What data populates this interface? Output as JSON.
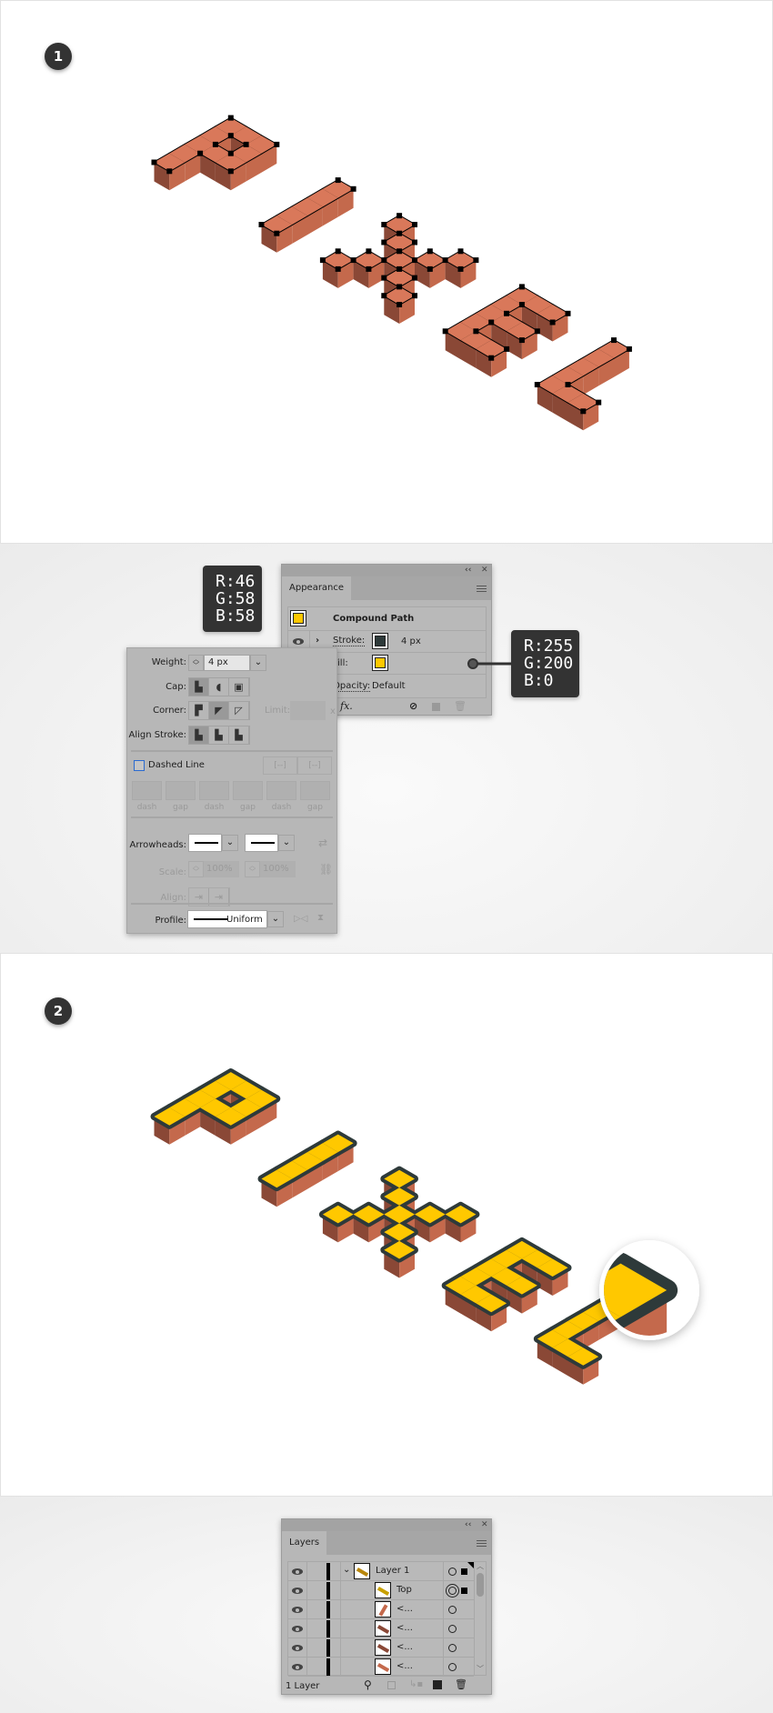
{
  "steps": [
    {
      "number": "1"
    },
    {
      "number": "2"
    }
  ],
  "colors": {
    "brick_top": "#d9785a",
    "brick_left": "#8a4836",
    "brick_right": "#c4694c",
    "fill_yellow": "#ffc800",
    "stroke_dark": "#2e3a3a"
  },
  "color_tooltips": {
    "stroke": {
      "r": "R:46",
      "g": "G:58",
      "b": "B:58"
    },
    "fill": {
      "r": "R:255",
      "g": "G:200",
      "b": "B:0"
    }
  },
  "appearance": {
    "tab": "Appearance",
    "object": "Compound Path",
    "stroke_label": "Stroke:",
    "stroke_value": "4 px",
    "fill_label": "Fill:",
    "opacity_label": "Opacity:",
    "opacity_value": "Default",
    "fx": "fx."
  },
  "stroke_panel": {
    "weight_label": "Weight:",
    "weight_value": "4 px",
    "cap_label": "Cap:",
    "corner_label": "Corner:",
    "limit_label": "Limit:",
    "limit_suffix": "x",
    "align_label": "Align Stroke:",
    "dashed_label": "Dashed Line",
    "dashed_checked": false,
    "dash_labels": [
      "dash",
      "gap",
      "dash",
      "gap",
      "dash",
      "gap"
    ],
    "arrowheads_label": "Arrowheads:",
    "scale_label": "Scale:",
    "scale_start": "100%",
    "scale_end": "100%",
    "align_arrow_label": "Align:",
    "profile_label": "Profile:",
    "profile_value": "Uniform"
  },
  "layers": {
    "tab": "Layers",
    "rows": [
      {
        "name": "Layer 1",
        "type": "layer"
      },
      {
        "name": "Top",
        "type": "group"
      },
      {
        "name": "<...",
        "type": "path"
      },
      {
        "name": "<...",
        "type": "path"
      },
      {
        "name": "<...",
        "type": "path"
      },
      {
        "name": "<...",
        "type": "path"
      }
    ],
    "footer": "1 Layer"
  }
}
